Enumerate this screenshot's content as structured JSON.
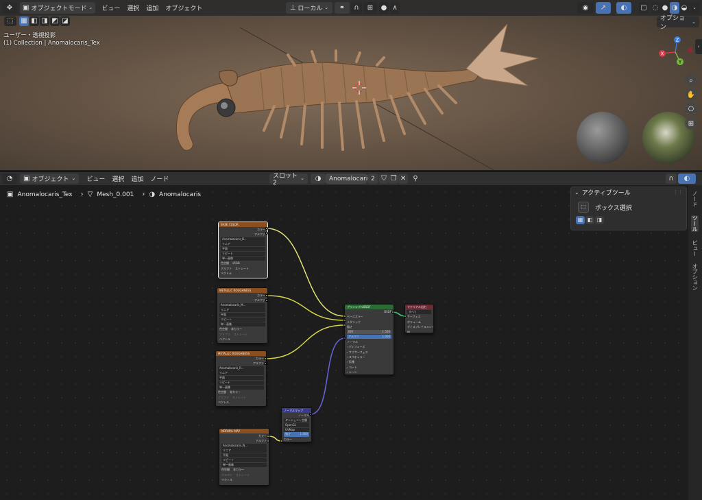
{
  "viewport": {
    "mode_label": "オブジェクトモード",
    "menus": [
      "ビュー",
      "選択",
      "追加",
      "オブジェクト"
    ],
    "transform_orientation": "ローカル",
    "options_label": "オプション",
    "overlay_line1": "ユーザー・透視投影",
    "overlay_line2": "(1) Collection | Anomalocaris_Tex",
    "gizmo_axes": {
      "x": "X",
      "y": "Y",
      "z": "Z"
    }
  },
  "node_editor": {
    "mode_label": "オブジェクト",
    "menus": [
      "ビュー",
      "選択",
      "追加",
      "ノード"
    ],
    "slot_label": "スロット2",
    "material_name": "Anomalocaris",
    "user_count": "2",
    "breadcrumb": {
      "object": "Anomalocaris_Tex",
      "mesh": "Mesh_0.001",
      "material": "Anomalocaris"
    }
  },
  "side_panel": {
    "title": "アクティブツール",
    "tool_name": "ボックス選択",
    "tabs": [
      "ノード",
      "ツール",
      "ビュー",
      "オプション"
    ]
  },
  "nodes": {
    "tex1": {
      "title": "BASE COLOR",
      "out_color": "カラー",
      "out_alpha": "アルファ",
      "image": "Anomalocaris_B...",
      "rows": [
        "リニア",
        "平面",
        "リピート",
        "単一画像"
      ],
      "colorspace_label": "色空間",
      "colorspace": "sRGB",
      "alpha_label": "アルファ",
      "alpha": "ストレート",
      "vector": "ベクトル"
    },
    "tex2": {
      "title": "METALLIC ROUGHNESS",
      "out_color": "カラー",
      "out_alpha": "アルファ",
      "image": "Anomalocaris_M...",
      "rows": [
        "リニア",
        "平面",
        "リピート",
        "単一画像"
      ],
      "colorspace_label": "色空間",
      "colorspace": "非カラー",
      "alpha_label": "アルファ",
      "alpha": "ストレート",
      "vector": "ベクトル"
    },
    "tex3": {
      "title": "METALLIC ROUGHNESS",
      "out_color": "カラー",
      "out_alpha": "アルファ",
      "image": "Anomalocaris_R...",
      "rows": [
        "リニア",
        "平面",
        "リピート",
        "単一画像"
      ],
      "colorspace_label": "色空間",
      "colorspace": "非カラー",
      "alpha_label": "アルファ",
      "alpha": "ストレート",
      "vector": "ベクトル"
    },
    "tex4": {
      "title": "NORMAL MAP",
      "out_color": "カラー",
      "out_alpha": "アルファ",
      "image": "Anomalocaris_N...",
      "rows": [
        "リニア",
        "平面",
        "リピート",
        "単一画像"
      ],
      "colorspace_label": "色空間",
      "colorspace": "非カラー",
      "alpha_label": "アルファ",
      "alpha": "ストレート",
      "vector": "ベクトル"
    },
    "bsdf": {
      "title": "プリンシプルBSDF",
      "out": "BSDF",
      "inputs": [
        "ベースカラー",
        "メタリック",
        "粗さ"
      ],
      "ior_label": "IOR",
      "ior": "1.500",
      "alpha_label": "アルファ",
      "alpha": "1.000",
      "normal": "ノーマル",
      "panels": [
        "ディフューズ",
        "サブサーフェス",
        "スペキュラー",
        "伝播",
        "コート",
        "シーン",
        "放射",
        "薄膜"
      ]
    },
    "output": {
      "title": "マテリアル出力",
      "target": "すべて",
      "inputs": [
        "サーフェス",
        "ボリューム",
        "ディスプレイスメント",
        "幅"
      ]
    },
    "normalmap": {
      "title": "ノーマルマップ",
      "out": "ノーマル",
      "space": "タンジェント空間",
      "convention": "OpenGL",
      "uv": "UVMap",
      "strength_label": "強さ",
      "strength": "1.000",
      "color": "カラー"
    }
  }
}
